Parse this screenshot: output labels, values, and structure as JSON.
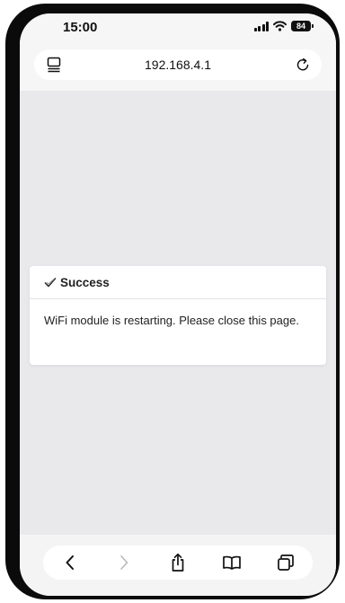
{
  "status_bar": {
    "time": "15:00",
    "battery": "84",
    "icons": [
      "signal-icon",
      "wifi-icon",
      "battery-icon"
    ]
  },
  "browser": {
    "url": "192.168.4.1",
    "icons": [
      "tab-overview-icon",
      "reload-icon"
    ]
  },
  "dialog": {
    "title": "Success",
    "message": "WiFi module is restarting. Please close this page.",
    "icon": "check-icon"
  },
  "toolbar": {
    "icons": [
      "back-icon",
      "forward-icon",
      "share-icon",
      "bookmarks-icon",
      "tabs-icon"
    ]
  },
  "colors": {
    "page_background": "#e9e9ec",
    "card_background": "#ffffff",
    "device_frame": "#0b0b0b"
  }
}
